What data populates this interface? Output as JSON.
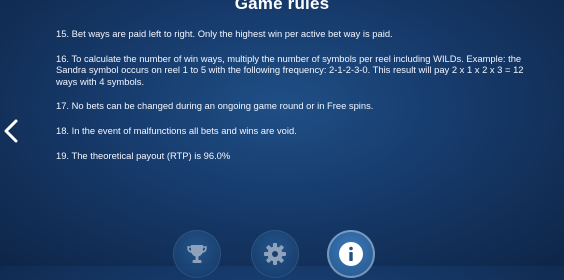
{
  "header": {
    "title": "Game rules"
  },
  "rules": [
    {
      "text": "15. Bet ways are paid left to right. Only the highest win per active bet way is paid."
    },
    {
      "text": "16. To calculate the number of win ways, multiply the number of symbols per reel including WILDs. Example: the Sandra symbol occurs on reel 1 to 5 with the following frequency:  2-1-2-3-0. This result will pay 2 x 1 x 2 x 3 = 12 ways with 4 symbols."
    },
    {
      "text": "17. No bets can be changed during an ongoing game round or in Free spins."
    },
    {
      "text": "18. In the event of malfunctions all bets and wins are void."
    },
    {
      "text": "19. The theoretical payout (RTP) is 96.0%"
    }
  ],
  "navigation": {
    "prev_icon": "chevron-left-icon"
  },
  "footer": {
    "buttons": [
      {
        "icon": "trophy-icon",
        "state": "inactive"
      },
      {
        "icon": "gear-icon",
        "state": "inactive"
      },
      {
        "icon": "info-icon",
        "state": "active"
      }
    ]
  },
  "colors": {
    "background": "#163a6b",
    "text": "#ffffff",
    "button_inactive": "#1a4476",
    "button_active": "#2b5f97"
  }
}
